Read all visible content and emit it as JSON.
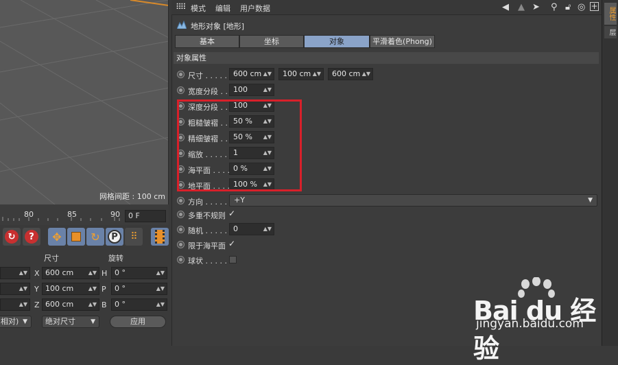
{
  "viewport": {
    "grid_label": "网格间距 : 100 cm"
  },
  "timeline": {
    "ticks": [
      "80",
      "85",
      "90"
    ],
    "frame": "0 F"
  },
  "coord_manager": {
    "size_header": "尺寸",
    "rotation_header": "旋转",
    "rows": [
      {
        "axis": "X",
        "size": "600 cm",
        "rot_label": "H",
        "rot": "0 °"
      },
      {
        "axis": "Y",
        "size": "100 cm",
        "rot_label": "P",
        "rot": "0 °"
      },
      {
        "axis": "Z",
        "size": "600 cm",
        "rot_label": "B",
        "rot": "0 °"
      }
    ],
    "mode_left": "相对)",
    "mode_size": "绝对尺寸",
    "apply": "应用"
  },
  "attr": {
    "menu": [
      "模式",
      "编辑",
      "用户数据"
    ],
    "object_title": "地形对象 [地形]",
    "tabs": [
      "基本",
      "坐标",
      "对象",
      "平滑着色(Phong)"
    ],
    "active_tab": "对象",
    "section": "对象属性",
    "size_label": "尺寸 . . . . .",
    "size_values": [
      "600 cm",
      "100 cm",
      "600 cm"
    ],
    "width_seg_label": "宽度分段 . .",
    "width_seg": "100",
    "depth_seg_label": "深度分段 . .",
    "depth_seg": "100",
    "rough_label": "粗糙皱褶 . .",
    "rough": "50 %",
    "fine_label": "精细皱褶 . .",
    "fine": "50 %",
    "scale_label": "缩放 . . . . .",
    "scale": "1",
    "sea_label": "海平面 . . . .",
    "sea": "0 %",
    "plane_label": "地平面 . . . .",
    "plane": "100 %",
    "direction_label": "方向 . . . . .",
    "direction": "+Y",
    "multi_label": "多重不规则",
    "multi_check": "✓",
    "random_label": "随机 . . . . .",
    "random": "0",
    "limit_label": "限于海平面",
    "limit_check": "✓",
    "sphere_label": "球状 . . . . ."
  },
  "side_tabs": [
    "属性",
    "层"
  ],
  "watermark": {
    "logo": "Bai du 经验",
    "url": "jingyan.baidu.com"
  }
}
